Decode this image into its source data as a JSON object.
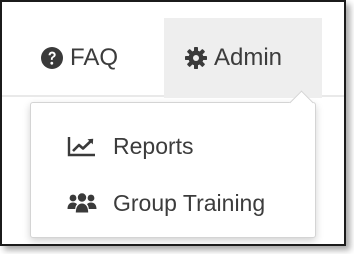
{
  "nav": {
    "faq": {
      "label": "FAQ",
      "icon": "question-circle-icon"
    },
    "admin": {
      "label": "Admin",
      "icon": "gear-icon"
    }
  },
  "admin_menu": {
    "items": [
      {
        "label": "Reports",
        "icon": "line-chart-icon"
      },
      {
        "label": "Group Training",
        "icon": "users-icon"
      }
    ]
  },
  "colors": {
    "text": "#3c3c3c",
    "active_nav_bg": "#eeeeee",
    "icon": "#3a3a3a"
  }
}
